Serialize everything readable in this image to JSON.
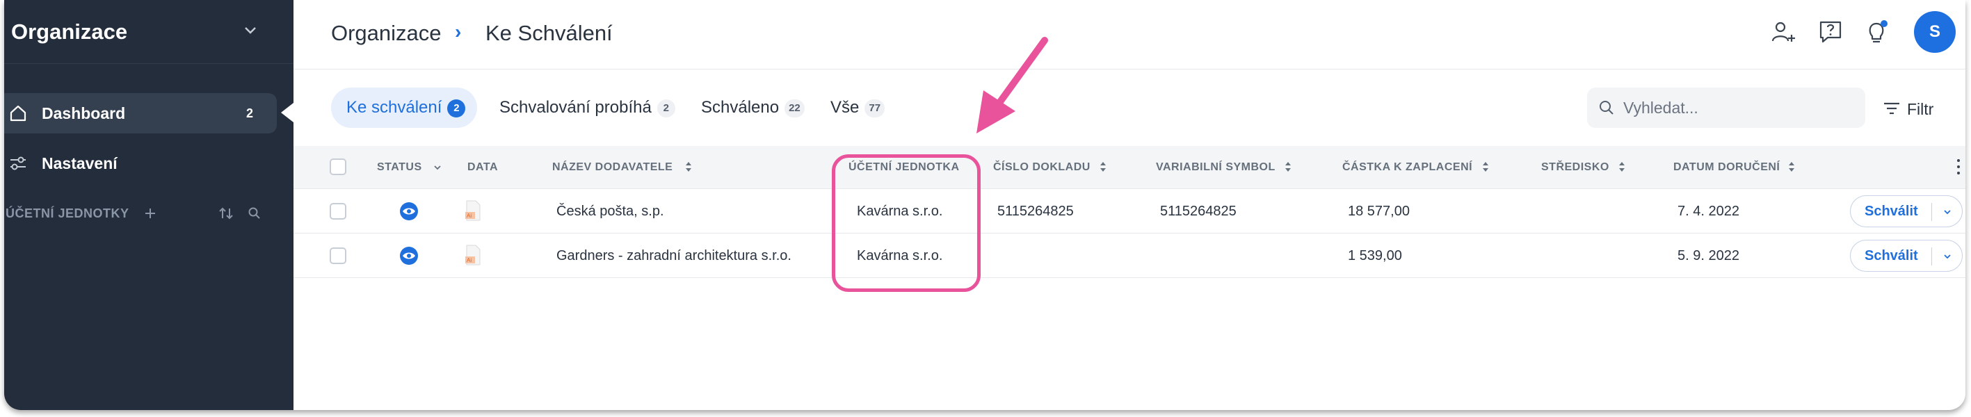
{
  "sidebar": {
    "org_title": "Organizace",
    "items": [
      {
        "label": "Dashboard",
        "count": "2",
        "icon": "home-icon"
      },
      {
        "label": "Nastavení",
        "icon": "settings-sliders-icon"
      }
    ],
    "units_section_label": "ÚČETNÍ JEDNOTKY"
  },
  "header": {
    "breadcrumb_root": "Organizace",
    "breadcrumb_separator": "›",
    "breadcrumb_current": "Ke Schválení",
    "avatar_initial": "S",
    "accent_color": "#1f6fdc"
  },
  "tabs": [
    {
      "label": "Ke schválení",
      "count": "2"
    },
    {
      "label": "Schvalování probíhá",
      "count": "2"
    },
    {
      "label": "Schváleno",
      "count": "22"
    },
    {
      "label": "Vše",
      "count": "77"
    }
  ],
  "search": {
    "placeholder": "Vyhledat..."
  },
  "filter_label": "Filtr",
  "table": {
    "columns": [
      "STATUS",
      "DATA",
      "NÁZEV DODAVATELE",
      "ÚČETNÍ JEDNOTKA",
      "ČÍSLO DOKLADU",
      "VARIABILNÍ SYMBOL",
      "ČÁSTKA K ZAPLACENÍ",
      "STŘEDISKO",
      "DATUM DORUČENÍ"
    ],
    "rows": [
      {
        "supplier": "Česká pošta, s.p.",
        "unit": "Kavárna s.r.o.",
        "doc_number": "5115264825",
        "var_symbol": "5115264825",
        "amount": "18 577,00",
        "center": "",
        "date": "7. 4. 2022",
        "action": "Schválit"
      },
      {
        "supplier": "Gardners - zahradní architektura s.r.o.",
        "unit": "Kavárna s.r.o.",
        "doc_number": "",
        "var_symbol": "",
        "amount": "1 539,00",
        "center": "",
        "date": "5. 9. 2022",
        "action": "Schválit"
      }
    ]
  },
  "annotation": {
    "color": "#e8539b"
  }
}
